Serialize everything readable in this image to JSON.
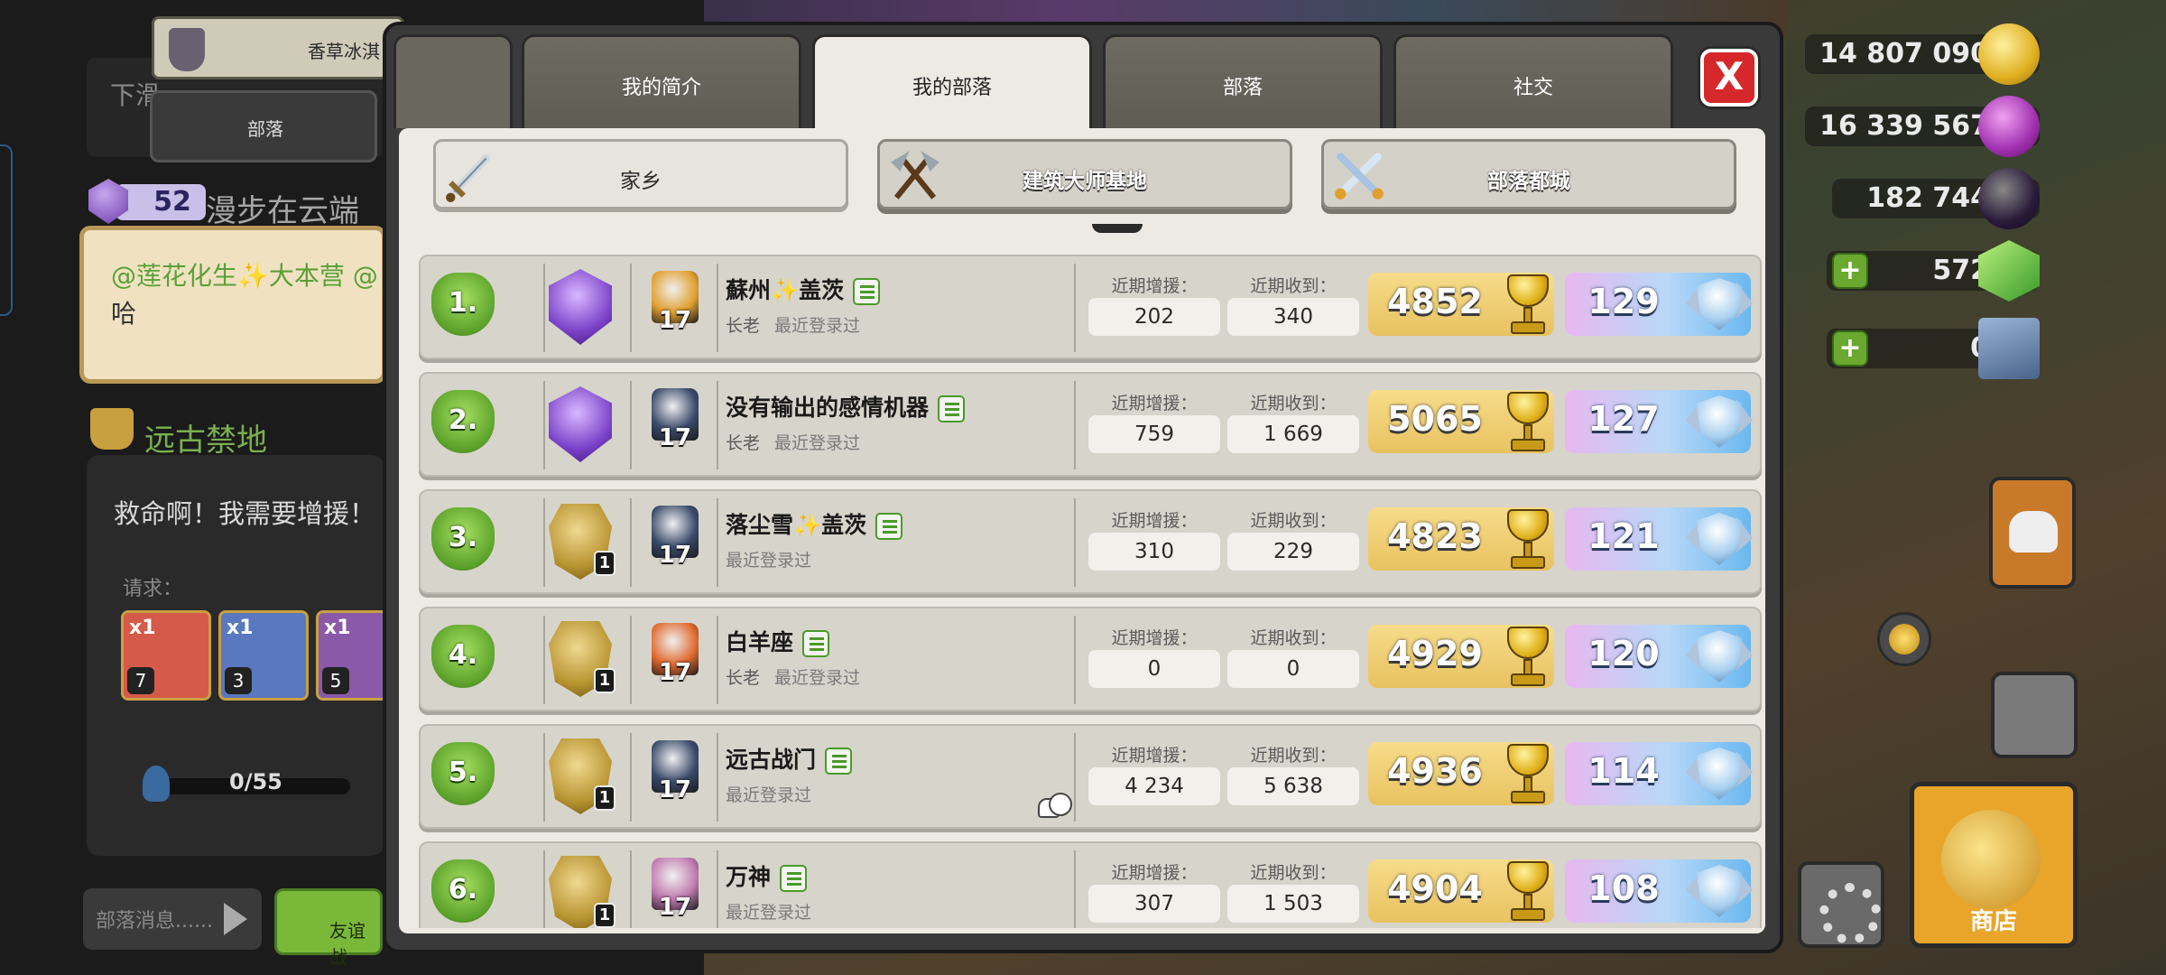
{
  "background": {
    "chat": {
      "banner_name": "香草冰淇",
      "down_text": "下滑",
      "clan_tab_label": "部落",
      "user_level": "52",
      "user_name": "漫步在云端",
      "message_mention": "@莲花化生✨大本营 @",
      "message_text": "哈",
      "elder_name": "远古禁地",
      "request_title": "救命啊！我需要增援！",
      "request_label": "请求：",
      "troops": [
        {
          "count": "x1",
          "level": "7",
          "color": "#d65a4a"
        },
        {
          "count": "x1",
          "level": "3",
          "color": "#5a78c0"
        },
        {
          "count": "x1",
          "level": "5",
          "color": "#8a5aa8"
        }
      ],
      "progress_text": "0/55",
      "progress_fraction": 0.0,
      "message_placeholder": "部落消息......",
      "green_button_label": "友谊战"
    },
    "hud": {
      "gold": "14 807 090",
      "elixir": "16 339 567",
      "dark_elixir": "182 744",
      "gems": "572",
      "pass": "0",
      "shop_label": "商店"
    }
  },
  "tabs": [
    {
      "label": "我的简介",
      "active": false
    },
    {
      "label": "我的部落",
      "active": true
    },
    {
      "label": "部落",
      "active": false
    },
    {
      "label": "社交",
      "active": false
    }
  ],
  "close_label": "X",
  "subtabs": [
    {
      "label": "家乡",
      "active": true,
      "icon": "sword-icon"
    },
    {
      "label": "建筑大师基地",
      "active": false,
      "icon": "crossed-axes-icon"
    },
    {
      "label": "部落都城",
      "active": false,
      "icon": "crossed-swords-icon"
    }
  ],
  "stat_labels": {
    "donated": "近期增援：",
    "received": "近期收到："
  },
  "members": [
    {
      "rank": "1.",
      "name": "蘇州✨盖茨",
      "role": "长老",
      "last_login": "最近登录过",
      "league": "legend",
      "league_num": "",
      "th_level": "17",
      "th_color": "#e0a030",
      "donated": "202",
      "received": "340",
      "trophies": "4852",
      "builder_trophies": "129",
      "group": false
    },
    {
      "rank": "2.",
      "name": "没有输出的感情机器",
      "role": "长老",
      "last_login": "最近登录过",
      "league": "legend",
      "league_num": "",
      "th_level": "17",
      "th_color": "#3a4a6a",
      "donated": "759",
      "received": "1 669",
      "trophies": "5065",
      "builder_trophies": "127",
      "group": false
    },
    {
      "rank": "3.",
      "name": "落尘雪✨盖茨",
      "role": "",
      "last_login": "最近登录过",
      "league": "unranked",
      "league_num": "1",
      "th_level": "17",
      "th_color": "#3a4a6a",
      "donated": "310",
      "received": "229",
      "trophies": "4823",
      "builder_trophies": "121",
      "group": false
    },
    {
      "rank": "4.",
      "name": "白羊座",
      "role": "长老",
      "last_login": "最近登录过",
      "league": "unranked",
      "league_num": "1",
      "th_level": "17",
      "th_color": "#e06a30",
      "donated": "0",
      "received": "0",
      "trophies": "4929",
      "builder_trophies": "120",
      "group": false
    },
    {
      "rank": "5.",
      "name": "远古战门",
      "role": "",
      "last_login": "最近登录过",
      "league": "unranked",
      "league_num": "1",
      "th_level": "17",
      "th_color": "#3a4a6a",
      "donated": "4 234",
      "received": "5 638",
      "trophies": "4936",
      "builder_trophies": "114",
      "group": true
    },
    {
      "rank": "6.",
      "name": "万神",
      "role": "",
      "last_login": "最近登录过",
      "league": "unranked",
      "league_num": "1",
      "th_level": "17",
      "th_color": "#c07ab0",
      "donated": "307",
      "received": "1 503",
      "trophies": "4904",
      "builder_trophies": "108",
      "group": false
    }
  ]
}
